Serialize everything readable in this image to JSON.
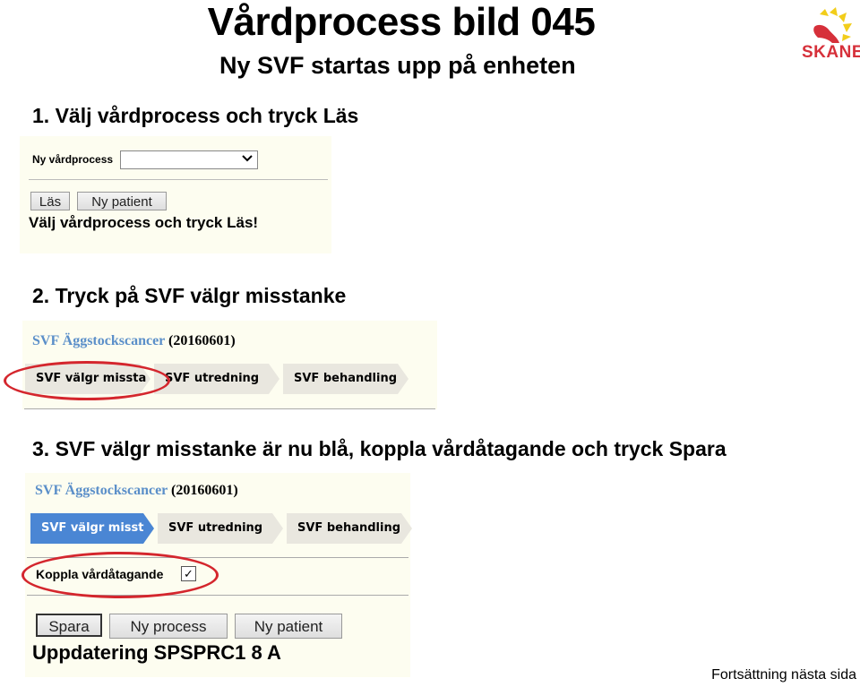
{
  "slide": {
    "title": "Vårdprocess bild 045",
    "subtitle": "Ny SVF startas upp på enheten",
    "logo_text": "SKANE",
    "footer": "Fortsättning nästa sida"
  },
  "steps": [
    {
      "label": "1. Välj vårdprocess och tryck Läs"
    },
    {
      "label": "2. Tryck på SVF välgr misstanke"
    },
    {
      "label": "3. SVF välgr misstanke är nu blå, koppla vårdåtagande och tryck Spara"
    }
  ],
  "panel1": {
    "select_label": "Ny vårdprocess",
    "select_value": "",
    "buttons": {
      "las": "Läs",
      "ny_patient": "Ny patient"
    },
    "message": "Välj vårdprocess och tryck Läs!"
  },
  "panel2": {
    "process_name": "SVF Äggstockscancer",
    "process_date": "(20160601)",
    "phases": [
      "SVF välgr missta",
      "SVF utredning",
      "SVF behandling"
    ],
    "active_phase": null
  },
  "panel3": {
    "process_name": "SVF Äggstockscancer",
    "process_date": "(20160601)",
    "phases": [
      "SVF välgr misst",
      "SVF utredning",
      "SVF behandling"
    ],
    "active_phase": "SVF välgr misst",
    "checkbox_label": "Koppla vårdåtagande",
    "checkbox_checked": true,
    "checkbox_mark": "✓",
    "buttons": {
      "spara": "Spara",
      "ny_process": "Ny process",
      "ny_patient": "Ny patient"
    },
    "message": "Uppdatering SPSPRC1 8 A"
  },
  "colors": {
    "active_phase": "#4a86d4",
    "process_name": "#5b8fc9",
    "highlight_ellipse": "#d4262d"
  }
}
